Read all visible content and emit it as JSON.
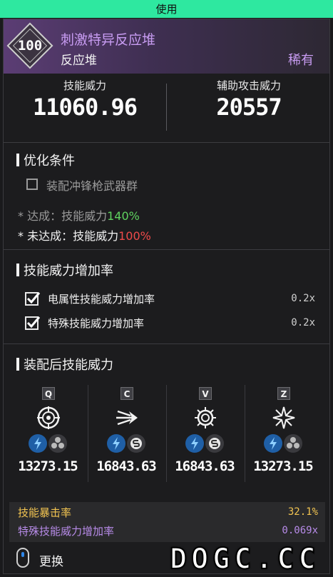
{
  "topbar": {
    "label": "使用"
  },
  "header": {
    "level": "100",
    "title": "刺激特异反应堆",
    "subtitle": "反应堆",
    "rarity": "稀有"
  },
  "stats": {
    "skill_power_label": "技能威力",
    "skill_power_value": "11060.96",
    "assist_power_label": "辅助攻击威力",
    "assist_power_value": "20557"
  },
  "optimize": {
    "title": "优化条件",
    "condition": "装配冲锋枪武器群",
    "achieved_prefix": "* 达成：技能威力",
    "achieved_value": "140%",
    "not_achieved_prefix": "* 未达成：技能威力",
    "not_achieved_value": "100%"
  },
  "boost": {
    "title": "技能威力增加率",
    "items": [
      {
        "label": "电属性技能威力增加率",
        "value": "0.2x",
        "checked": true
      },
      {
        "label": "特殊技能威力增加率",
        "value": "0.2x",
        "checked": true
      }
    ]
  },
  "equipped": {
    "title": "装配后技能威力",
    "skills": [
      {
        "key": "Q",
        "icon": "target-crosshair-icon",
        "value": "13273.15",
        "elements": [
          "lightning-icon",
          "fan-icon"
        ]
      },
      {
        "key": "C",
        "icon": "dash-burst-icon",
        "value": "16843.63",
        "elements": [
          "lightning-icon",
          "s-mark-icon"
        ]
      },
      {
        "key": "V",
        "icon": "sun-gear-icon",
        "value": "16843.63",
        "elements": [
          "lightning-icon",
          "s-mark-icon"
        ]
      },
      {
        "key": "Z",
        "icon": "starburst-icon",
        "value": "13273.15",
        "elements": [
          "lightning-icon",
          "fan-icon"
        ]
      }
    ]
  },
  "bottom": {
    "crit_label": "技能暴击率",
    "crit_value": "32.1%",
    "special_label": "特殊技能威力增加率",
    "special_value": "0.069x"
  },
  "footer": {
    "label": "更换",
    "watermark": "DOGC.CC"
  },
  "colors": {
    "accent": "#2ee8a0",
    "rare_purple": "#c89cf2",
    "green": "#5fd35f",
    "red": "#ee4a4a",
    "gold": "#f2c451",
    "violet": "#b78be8"
  }
}
